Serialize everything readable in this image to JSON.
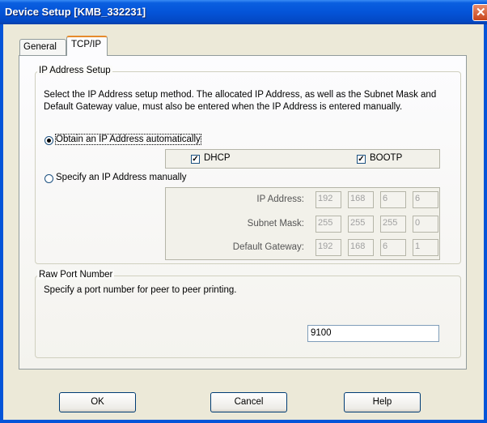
{
  "window": {
    "title": "Device Setup [KMB_332231]"
  },
  "tabs": [
    {
      "label": "General"
    },
    {
      "label": "TCP/IP"
    }
  ],
  "ip_setup": {
    "group_label": "IP Address Setup",
    "description": "Select the IP Address setup method. The allocated IP Address, as well as the Subnet Mask and Default Gateway value, must also be entered when the IP Address is entered manually.",
    "auto_label": "Obtain an IP Address automatically",
    "auto_selected": true,
    "dhcp_label": "DHCP",
    "dhcp_checked": true,
    "bootp_label": "BOOTP",
    "bootp_checked": true,
    "manual_label": "Specify an IP Address manually",
    "manual_selected": false,
    "ip_label": "IP Address:",
    "ip": [
      "192",
      "168",
      "6",
      "6"
    ],
    "subnet_label": "Subnet Mask:",
    "subnet": [
      "255",
      "255",
      "255",
      "0"
    ],
    "gateway_label": "Default Gateway:",
    "gateway": [
      "192",
      "168",
      "6",
      "1"
    ]
  },
  "raw_port": {
    "group_label": "Raw Port Number",
    "description": "Specify a port number for peer to peer printing.",
    "value": "9100"
  },
  "buttons": {
    "ok": "OK",
    "cancel": "Cancel",
    "help": "Help"
  },
  "icons": {
    "close": "close-icon",
    "radio_selected": "radio-dot-icon",
    "check": "checkmark-icon"
  }
}
